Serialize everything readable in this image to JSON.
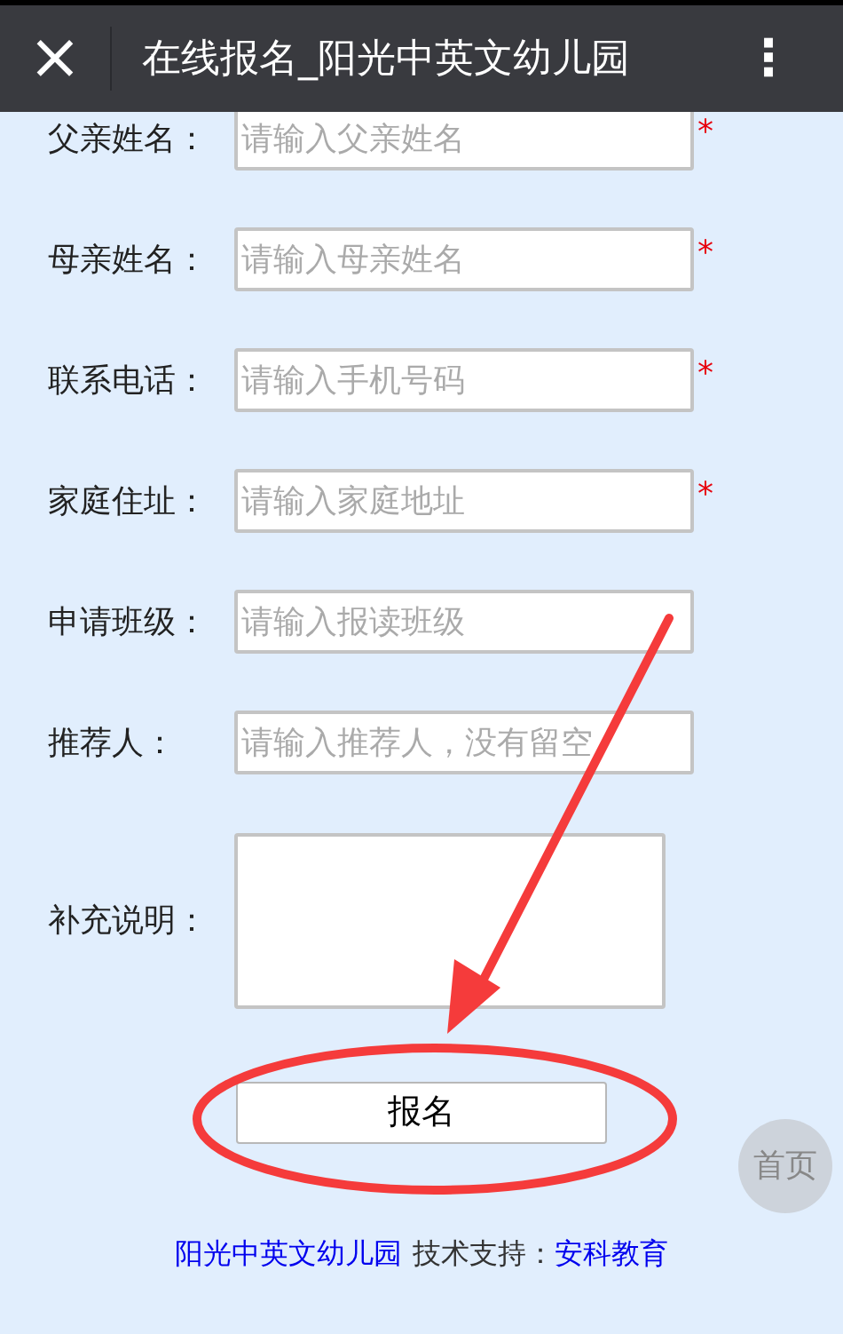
{
  "header": {
    "close": "×",
    "title": "在线报名_阳光中英文幼儿园",
    "menu": "⋮"
  },
  "fields": [
    {
      "kind": "input",
      "label": "父亲姓名：",
      "placeholder": "请输入父亲姓名",
      "required": true
    },
    {
      "kind": "input",
      "label": "母亲姓名：",
      "placeholder": "请输入母亲姓名",
      "required": true
    },
    {
      "kind": "input",
      "label": "联系电话：",
      "placeholder": "请输入手机号码",
      "required": true
    },
    {
      "kind": "input",
      "label": "家庭住址：",
      "placeholder": "请输入家庭地址",
      "required": true
    },
    {
      "kind": "input",
      "label": "申请班级：",
      "placeholder": "请输入报读班级",
      "required": false
    },
    {
      "kind": "input",
      "label": "推荐人：",
      "placeholder": "请输入推荐人，没有留空",
      "required": false
    },
    {
      "kind": "textarea",
      "label": "补充说明：",
      "required": false
    }
  ],
  "required_mark": "*",
  "submit": "报名",
  "home_button": "首页",
  "footer": {
    "site": "阳光中英文幼儿园",
    "support_label": "技术支持：",
    "support_link": "安科教育"
  }
}
